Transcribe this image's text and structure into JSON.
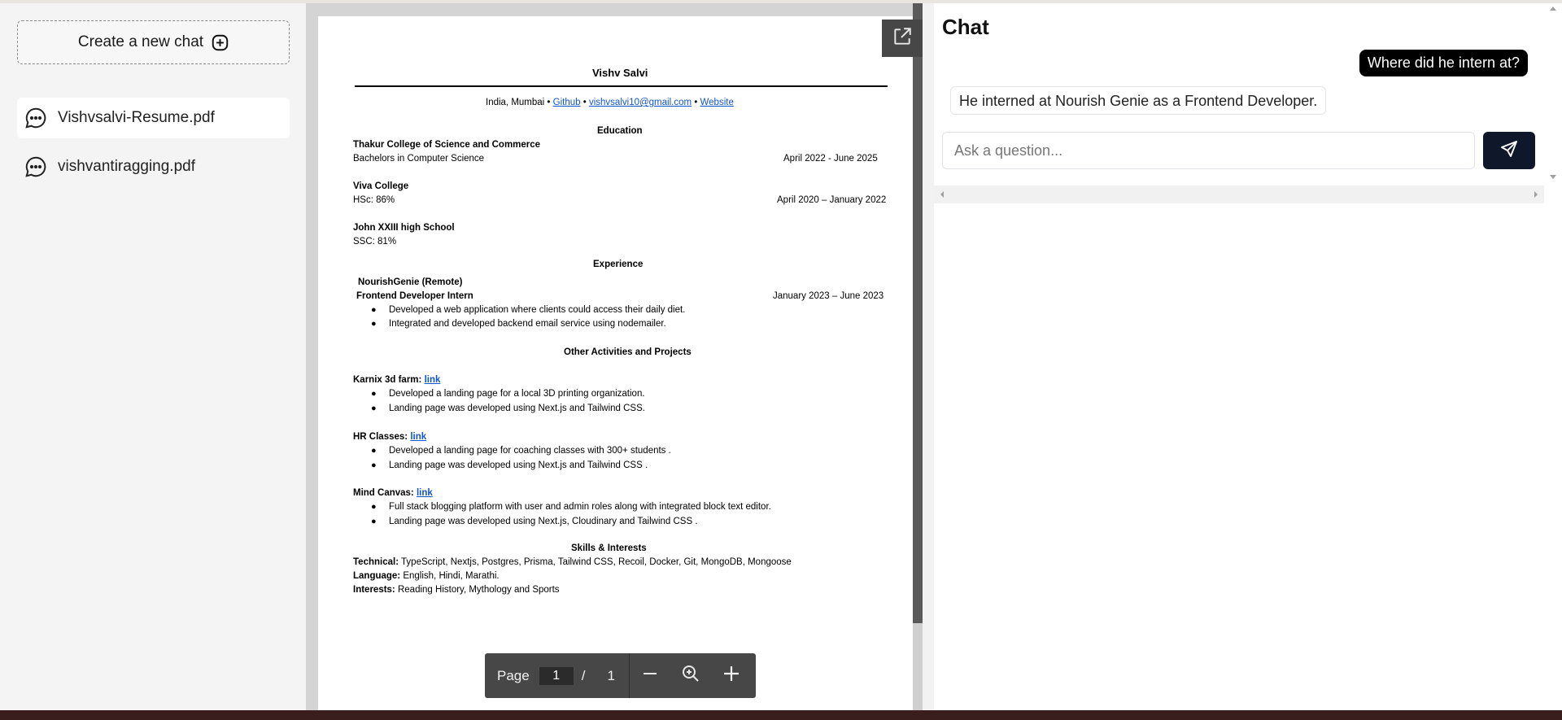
{
  "sidebar": {
    "new_chat_label": "Create a new chat",
    "items": [
      {
        "label": "Vishvsalvi-Resume.pdf"
      },
      {
        "label": "vishvantiragging.pdf"
      }
    ]
  },
  "resume": {
    "name": "Vishv Salvi",
    "contact_prefix": "India, Mumbai •",
    "github": "Github",
    "email": "vishvsalvi10@gmail.com",
    "website": "Website",
    "sep": "•",
    "education_heading": "Education",
    "edu1_school": "Thakur College of Science and Commerce",
    "edu1_degree": "Bachelors in Computer Science",
    "edu1_dates": "April 2022 -  June 2025",
    "edu2_school": "Viva College",
    "edu2_degree": "HSc: 86%",
    "edu2_dates": "April 2020 – January 2022",
    "edu3_school": "John XXIII high School",
    "edu3_degree": "SSC: 81%",
    "experience_heading": "Experience",
    "exp_company": "NourishGenie (Remote)",
    "exp_role": "Frontend Developer Intern",
    "exp_dates": "January 2023  – June 2023",
    "exp_b1": "Developed a web application where clients could access their daily diet.",
    "exp_b2": "Integrated and developed backend email service using nodemailer.",
    "projects_heading": "Other Activities and Projects",
    "p1_title": "Karnix 3d farm:",
    "p1_link": "link",
    "p1_b1": "Developed a landing page for a local 3D printing organization.",
    "p1_b2": "Landing page was developed using Next.js and Tailwind CSS.",
    "p2_title": "HR Classes:",
    "p2_link": "link",
    "p2_b1": "Developed a landing page for coaching classes with 300+ students .",
    "p2_b2": "Landing page was developed using Next.js and Tailwind CSS .",
    "p3_title": "Mind Canvas:",
    "p3_link": "link",
    "p3_b1": "Full stack blogging platform with user and admin roles along with integrated block text editor.",
    "p3_b2": "Landing page was developed using Next.js, Cloudinary  and Tailwind CSS .",
    "skills_heading": "Skills & Interests",
    "tech_label": "Technical:",
    "tech_value": "TypeScript, Nextjs, Postgres, Prisma, Tailwind CSS, Recoil, Docker, Git, MongoDB, Mongoose",
    "lang_label": "Language:",
    "lang_value": "English, Hindi, Marathi.",
    "int_label": "Interests:",
    "int_value": "Reading History, Mythology and Sports",
    "bullet": "●"
  },
  "toolbar": {
    "page_label": "Page",
    "current_page": "1",
    "separator": "/",
    "total_pages": "1"
  },
  "chat": {
    "title": "Chat",
    "user_message": "Where did he intern at?",
    "bot_message": "He interned at Nourish Genie as a Frontend Developer.",
    "input_placeholder": "Ask a question..."
  },
  "icons": [
    "plus-circle-icon",
    "message-circle-icon",
    "external-link-icon",
    "minus-icon",
    "zoom-icon",
    "plus-icon",
    "send-icon"
  ]
}
